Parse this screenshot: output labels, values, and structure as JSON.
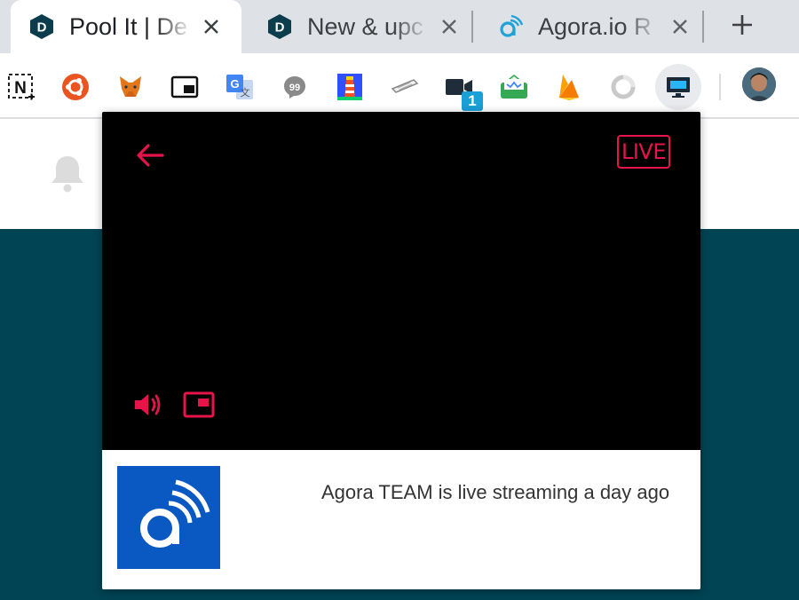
{
  "browser": {
    "tabs": [
      {
        "title": "Pool It | De",
        "favicon": "dev-icon",
        "active": true
      },
      {
        "title": "New & upc",
        "favicon": "dev-icon",
        "active": false
      },
      {
        "title": "Agora.io R",
        "favicon": "agora-icon",
        "active": false
      }
    ],
    "new_tab_icon": "plus-icon",
    "extensions": [
      "notion-web-clipper-icon",
      "ubuntu-circle-icon",
      "metamask-fox-icon",
      "picture-in-picture-icon",
      "google-translate-icon",
      "chat-bubble-icon",
      "lighthouse-icon",
      "keyboard-icon",
      "video-camera-icon",
      "email-tracker-icon",
      "firebase-icon",
      "refresh-circle-icon",
      "screen-share-icon"
    ],
    "video_ext_badge": "1"
  },
  "popup": {
    "live_label": "LIVE",
    "stream_text": "Agora TEAM is live streaming a day ago",
    "colors": {
      "accent": "#e5154b",
      "player_bg": "#000000",
      "channel_logo_bg": "#0a58c2"
    }
  },
  "page": {
    "colors": {
      "teal": "#014454"
    }
  }
}
